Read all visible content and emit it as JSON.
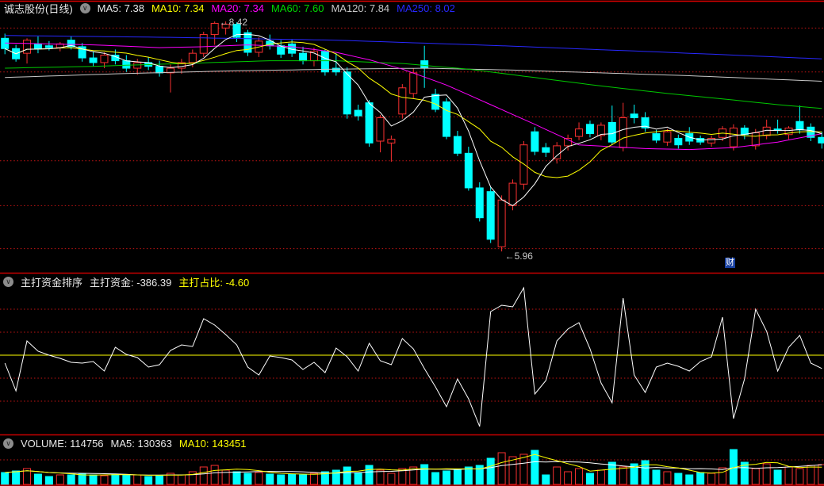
{
  "app": {
    "background": "#000000",
    "separator_color": "#c80000",
    "grid_dot_color": "#c41414",
    "up_color": "#f83030",
    "down_color": "#00ffff",
    "annotation_color": "#c8c8c8"
  },
  "panels": {
    "main": {
      "title": "诚志股份(日线)",
      "collapse_icon": "chevron-down",
      "ma_labels": [
        {
          "text": "MA5: 7.38",
          "color": "#e8e8e8"
        },
        {
          "text": "MA10: 7.34",
          "color": "#ffff00"
        },
        {
          "text": "MA20: 7.34",
          "color": "#ff00ff"
        },
        {
          "text": "MA60: 7.60",
          "color": "#00d800"
        },
        {
          "text": "MA120: 7.84",
          "color": "#c8c8c8"
        },
        {
          "text": "MA250: 8.02",
          "color": "#2828ff"
        }
      ],
      "high_label": "←8.42",
      "low_label": "←5.96",
      "marker": "财"
    },
    "indicator": {
      "title": "主打资金排序",
      "fields": [
        {
          "text": "主打资金: -386.39",
          "color": "#e8e8e8"
        },
        {
          "text": "主打占比: -4.60",
          "color": "#ffff00"
        }
      ]
    },
    "volume": {
      "fields": [
        {
          "text": "VOLUME: 114756",
          "color": "#e8e8e8"
        },
        {
          "text": "MA5: 130363",
          "color": "#e8e8e8"
        },
        {
          "text": "MA10: 143451",
          "color": "#ffff00"
        }
      ]
    }
  },
  "chart_data": [
    {
      "type": "candlestick",
      "title": "诚志股份 日线",
      "ylim": [
        5.8,
        8.48
      ],
      "grid_prices": [
        8.35,
        7.88,
        7.4,
        6.93,
        6.45,
        5.99
      ],
      "high_annotation": {
        "index": 19,
        "price": 8.42
      },
      "low_annotation": {
        "index": 45,
        "price": 5.96
      },
      "candles": [
        [
          8.24,
          8.29,
          8.07,
          8.13,
          "d"
        ],
        [
          8.13,
          8.17,
          7.99,
          8.02,
          "d"
        ],
        [
          8.08,
          8.24,
          7.97,
          8.22,
          "u"
        ],
        [
          8.18,
          8.26,
          8.08,
          8.13,
          "d"
        ],
        [
          8.16,
          8.21,
          8.11,
          8.14,
          "d"
        ],
        [
          8.14,
          8.2,
          8.1,
          8.18,
          "u"
        ],
        [
          8.22,
          8.26,
          8.12,
          8.15,
          "d"
        ],
        [
          8.15,
          8.19,
          7.99,
          8.03,
          "d"
        ],
        [
          8.03,
          8.1,
          7.94,
          7.98,
          "d"
        ],
        [
          7.98,
          8.09,
          7.92,
          8.06,
          "u"
        ],
        [
          8.06,
          8.12,
          7.96,
          8.0,
          "d"
        ],
        [
          8.0,
          8.06,
          7.88,
          7.92,
          "d"
        ],
        [
          7.92,
          8.02,
          7.85,
          7.98,
          "u"
        ],
        [
          7.98,
          8.04,
          7.9,
          7.94,
          "d"
        ],
        [
          7.94,
          8.0,
          7.83,
          7.87,
          "d"
        ],
        [
          7.87,
          7.96,
          7.66,
          7.92,
          "u"
        ],
        [
          7.92,
          8.02,
          7.86,
          7.98,
          "u"
        ],
        [
          7.98,
          8.12,
          7.93,
          8.08,
          "u"
        ],
        [
          8.08,
          8.31,
          8.04,
          8.28,
          "u"
        ],
        [
          8.28,
          8.42,
          8.17,
          8.4,
          "u"
        ],
        [
          8.35,
          8.42,
          8.28,
          8.39,
          "u"
        ],
        [
          8.39,
          8.41,
          8.2,
          8.25,
          "d"
        ],
        [
          8.3,
          8.33,
          8.05,
          8.09,
          "d"
        ],
        [
          8.09,
          8.25,
          8.04,
          8.21,
          "u"
        ],
        [
          8.21,
          8.28,
          8.12,
          8.16,
          "d"
        ],
        [
          8.16,
          8.22,
          8.03,
          8.07,
          "d"
        ],
        [
          8.18,
          8.23,
          8.04,
          8.08,
          "d"
        ],
        [
          8.08,
          8.15,
          7.96,
          8.0,
          "d"
        ],
        [
          8.0,
          8.14,
          7.94,
          8.1,
          "u"
        ],
        [
          8.1,
          8.12,
          7.84,
          7.88,
          "d"
        ],
        [
          7.92,
          8.08,
          7.84,
          7.88,
          "d"
        ],
        [
          7.88,
          7.93,
          7.38,
          7.43,
          "d"
        ],
        [
          7.47,
          7.53,
          7.36,
          7.41,
          "d"
        ],
        [
          7.55,
          7.58,
          7.08,
          7.12,
          "d"
        ],
        [
          7.14,
          7.42,
          7.02,
          7.39,
          "u"
        ],
        [
          7.12,
          7.2,
          6.92,
          7.16,
          "u"
        ],
        [
          7.43,
          7.75,
          7.38,
          7.71,
          "u"
        ],
        [
          7.65,
          7.92,
          7.6,
          7.87,
          "u"
        ],
        [
          8.0,
          8.16,
          7.71,
          7.92,
          "d"
        ],
        [
          7.64,
          7.7,
          7.45,
          7.48,
          "d"
        ],
        [
          7.56,
          7.6,
          7.16,
          7.19,
          "d"
        ],
        [
          7.19,
          7.25,
          6.98,
          7.01,
          "d"
        ],
        [
          7.01,
          7.08,
          6.61,
          6.64,
          "d"
        ],
        [
          6.64,
          6.7,
          6.28,
          6.32,
          "d"
        ],
        [
          6.6,
          6.65,
          6.05,
          6.09,
          "d"
        ],
        [
          6.01,
          6.56,
          5.96,
          6.51,
          "u"
        ],
        [
          6.45,
          6.73,
          6.4,
          6.69,
          "u"
        ],
        [
          6.68,
          7.14,
          6.62,
          7.1,
          "u"
        ],
        [
          7.24,
          7.29,
          6.99,
          7.03,
          "d"
        ],
        [
          7.07,
          7.12,
          6.97,
          7.02,
          "d"
        ],
        [
          6.95,
          7.13,
          6.9,
          7.09,
          "u"
        ],
        [
          7.09,
          7.21,
          7.04,
          7.17,
          "u"
        ],
        [
          7.19,
          7.34,
          7.15,
          7.27,
          "u"
        ],
        [
          7.32,
          7.36,
          7.18,
          7.22,
          "d"
        ],
        [
          7.2,
          7.34,
          7.15,
          7.31,
          "u"
        ],
        [
          7.34,
          7.52,
          7.1,
          7.13,
          "d"
        ],
        [
          7.07,
          7.55,
          7.03,
          7.39,
          "u"
        ],
        [
          7.43,
          7.53,
          7.33,
          7.39,
          "d"
        ],
        [
          7.39,
          7.45,
          7.24,
          7.28,
          "d"
        ],
        [
          7.22,
          7.26,
          7.12,
          7.15,
          "d"
        ],
        [
          7.13,
          7.27,
          7.09,
          7.24,
          "u"
        ],
        [
          7.17,
          7.21,
          7.06,
          7.1,
          "d"
        ],
        [
          7.22,
          7.29,
          7.1,
          7.14,
          "d"
        ],
        [
          7.17,
          7.2,
          7.1,
          7.13,
          "d"
        ],
        [
          7.12,
          7.2,
          7.08,
          7.17,
          "u"
        ],
        [
          7.18,
          7.3,
          7.14,
          7.27,
          "u"
        ],
        [
          7.08,
          7.32,
          7.04,
          7.28,
          "u"
        ],
        [
          7.28,
          7.31,
          7.16,
          7.21,
          "d"
        ],
        [
          7.09,
          7.27,
          7.05,
          7.23,
          "u"
        ],
        [
          7.2,
          7.37,
          7.16,
          7.29,
          "u"
        ],
        [
          7.27,
          7.37,
          7.22,
          7.26,
          "d"
        ],
        [
          7.21,
          7.3,
          7.16,
          7.28,
          "u"
        ],
        [
          7.35,
          7.52,
          7.22,
          7.26,
          "d"
        ],
        [
          7.29,
          7.33,
          7.14,
          7.18,
          "d"
        ],
        [
          7.18,
          7.24,
          7.06,
          7.12,
          "d"
        ]
      ],
      "overlays": [
        {
          "name": "MA250",
          "color": "#2828ff",
          "points": [
            [
              0,
              8.27
            ],
            [
              15,
              8.25
            ],
            [
              30,
              8.22
            ],
            [
              45,
              8.16
            ],
            [
              60,
              8.09
            ],
            [
              74,
              8.02
            ]
          ]
        },
        {
          "name": "MA120",
          "color": "#c8c8c8",
          "points": [
            [
              0,
              7.82
            ],
            [
              10,
              7.86
            ],
            [
              20,
              7.89
            ],
            [
              30,
              7.91
            ],
            [
              38,
              7.92
            ],
            [
              46,
              7.9
            ],
            [
              54,
              7.87
            ],
            [
              62,
              7.84
            ],
            [
              68,
              7.81
            ],
            [
              74,
              7.78
            ]
          ]
        },
        {
          "name": "MA60",
          "color": "#00c800",
          "points": [
            [
              0,
              7.92
            ],
            [
              8,
              7.94
            ],
            [
              16,
              7.97
            ],
            [
              24,
              8.0
            ],
            [
              30,
              8.0
            ],
            [
              36,
              7.97
            ],
            [
              42,
              7.91
            ],
            [
              48,
              7.82
            ],
            [
              54,
              7.73
            ],
            [
              60,
              7.65
            ],
            [
              66,
              7.58
            ],
            [
              70,
              7.53
            ],
            [
              74,
              7.49
            ]
          ]
        },
        {
          "name": "MA20",
          "color": "#ff00ff",
          "points": [
            [
              0,
              8.19
            ],
            [
              8,
              8.17
            ],
            [
              14,
              8.14
            ],
            [
              18,
              8.15
            ],
            [
              22,
              8.17
            ],
            [
              26,
              8.15
            ],
            [
              30,
              8.09
            ],
            [
              33,
              8.01
            ],
            [
              36,
              7.91
            ],
            [
              40,
              7.74
            ],
            [
              44,
              7.53
            ],
            [
              48,
              7.32
            ],
            [
              52,
              7.1
            ],
            [
              58,
              7.06
            ],
            [
              62,
              7.05
            ],
            [
              66,
              7.07
            ],
            [
              70,
              7.13
            ],
            [
              74,
              7.22
            ]
          ]
        },
        {
          "name": "MA10",
          "color": "#ffff00",
          "window": 10
        },
        {
          "name": "MA5",
          "color": "#ffffff",
          "window": 5
        }
      ]
    },
    {
      "type": "line",
      "name": "主打资金",
      "color": "#ffffff",
      "zero_line_color": "#ffff00",
      "ylim": [
        -2208,
        1955
      ],
      "grid_values": [
        1334,
        667,
        -667,
        -1334
      ],
      "values": [
        -230,
        -1035,
        414,
        115,
        0,
        -92,
        -207,
        -230,
        -184,
        -460,
        230,
        23,
        -69,
        -345,
        -276,
        138,
        299,
        253,
        1058,
        874,
        598,
        299,
        -345,
        -575,
        -23,
        -69,
        -138,
        -414,
        -207,
        -506,
        207,
        -46,
        -460,
        345,
        -161,
        -276,
        483,
        184,
        -391,
        -920,
        -1495,
        -690,
        -1265,
        -2070,
        1265,
        1449,
        1403,
        1978,
        -1127,
        -736,
        414,
        759,
        943,
        184,
        -805,
        -1380,
        1656,
        -575,
        -1081,
        -345,
        -230,
        -322,
        -460,
        -184,
        -46,
        1104,
        -1840,
        -690,
        1334,
        690,
        -460,
        230,
        575,
        -230,
        -386.39
      ]
    },
    {
      "type": "bar",
      "name": "VOLUME",
      "ylim": [
        0,
        202000
      ],
      "grid_value": 142290,
      "ma_overlays": [
        {
          "name": "MA5",
          "color": "#ffff00",
          "window": 5
        },
        {
          "name": "MA10",
          "color": "#ffffff",
          "window": 10
        }
      ],
      "bars": [
        [
          68850,
          "d"
        ],
        [
          78030,
          "d"
        ],
        [
          91800,
          "u"
        ],
        [
          59670,
          "d"
        ],
        [
          45900,
          "d"
        ],
        [
          55080,
          "u"
        ],
        [
          55080,
          "d"
        ],
        [
          59670,
          "d"
        ],
        [
          55080,
          "d"
        ],
        [
          50490,
          "u"
        ],
        [
          59670,
          "d"
        ],
        [
          55080,
          "d"
        ],
        [
          55080,
          "u"
        ],
        [
          45900,
          "d"
        ],
        [
          50490,
          "d"
        ],
        [
          64260,
          "u"
        ],
        [
          55080,
          "u"
        ],
        [
          73440,
          "u"
        ],
        [
          100980,
          "u"
        ],
        [
          110160,
          "u"
        ],
        [
          82620,
          "u"
        ],
        [
          73440,
          "d"
        ],
        [
          64260,
          "d"
        ],
        [
          68850,
          "u"
        ],
        [
          59670,
          "d"
        ],
        [
          55080,
          "d"
        ],
        [
          59670,
          "d"
        ],
        [
          55080,
          "d"
        ],
        [
          64260,
          "u"
        ],
        [
          73440,
          "d"
        ],
        [
          82620,
          "d"
        ],
        [
          100980,
          "d"
        ],
        [
          64260,
          "d"
        ],
        [
          110160,
          "d"
        ],
        [
          82620,
          "u"
        ],
        [
          64260,
          "u"
        ],
        [
          91800,
          "u"
        ],
        [
          100980,
          "u"
        ],
        [
          114750,
          "d"
        ],
        [
          68850,
          "d"
        ],
        [
          78030,
          "d"
        ],
        [
          87210,
          "d"
        ],
        [
          100980,
          "d"
        ],
        [
          110160,
          "d"
        ],
        [
          151470,
          "d"
        ],
        [
          183600,
          "u"
        ],
        [
          160650,
          "u"
        ],
        [
          174420,
          "u"
        ],
        [
          197370,
          "d"
        ],
        [
          55080,
          "d"
        ],
        [
          100980,
          "u"
        ],
        [
          73440,
          "u"
        ],
        [
          91800,
          "u"
        ],
        [
          64260,
          "d"
        ],
        [
          82620,
          "u"
        ],
        [
          128520,
          "d"
        ],
        [
          100980,
          "u"
        ],
        [
          119340,
          "d"
        ],
        [
          137700,
          "d"
        ],
        [
          82620,
          "d"
        ],
        [
          73440,
          "u"
        ],
        [
          64260,
          "d"
        ],
        [
          55080,
          "d"
        ],
        [
          68850,
          "d"
        ],
        [
          64260,
          "u"
        ],
        [
          96390,
          "u"
        ],
        [
          201960,
          "d"
        ],
        [
          128520,
          "d"
        ],
        [
          91800,
          "u"
        ],
        [
          119340,
          "u"
        ],
        [
          82620,
          "d"
        ],
        [
          100980,
          "u"
        ],
        [
          91800,
          "u"
        ],
        [
          110160,
          "u"
        ],
        [
          114756,
          "u"
        ]
      ]
    }
  ]
}
